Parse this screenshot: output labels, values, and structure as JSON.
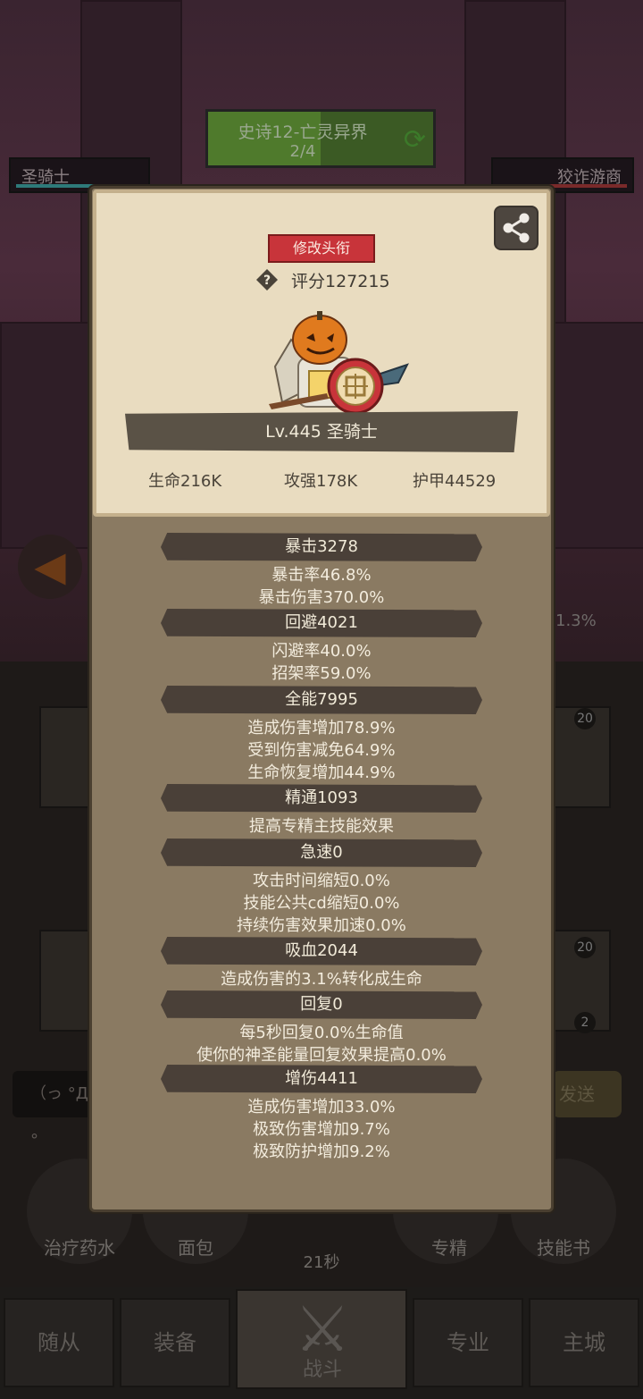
{
  "stage": {
    "name": "史诗12-亡灵异界",
    "progress": "2/4"
  },
  "player_tag": "圣骑士",
  "enemy_tag": "狡诈游商",
  "background": {
    "percent_text": "1.3%",
    "chat_placeholder": "（っ °Д °",
    "send_label": "发送",
    "badges": [
      "20",
      "20",
      "2"
    ],
    "items": [
      "治疗药水",
      "面包",
      "专精",
      "技能书"
    ],
    "timer": "21秒",
    "nav": [
      "随从",
      "装备",
      "战斗",
      "专业",
      "主城"
    ]
  },
  "panel": {
    "edit_title_label": "修改头衔",
    "score": "评分127215",
    "level_class": "Lv.445 圣骑士",
    "base_stats": [
      "生命216K",
      "攻强178K",
      "护甲44529"
    ],
    "sections": [
      {
        "header": "暴击3278",
        "lines": [
          "暴击率46.8%",
          "暴击伤害370.0%"
        ]
      },
      {
        "header": "回避4021",
        "lines": [
          "闪避率40.0%",
          "招架率59.0%"
        ]
      },
      {
        "header": "全能7995",
        "lines": [
          "造成伤害增加78.9%",
          "受到伤害减免64.9%",
          "生命恢复增加44.9%"
        ]
      },
      {
        "header": "精通1093",
        "lines": [
          "提高专精主技能效果"
        ]
      },
      {
        "header": "急速0",
        "lines": [
          "攻击时间缩短0.0%",
          "技能公共cd缩短0.0%",
          "持续伤害效果加速0.0%"
        ]
      },
      {
        "header": "吸血2044",
        "lines": [
          "造成伤害的3.1%转化成生命"
        ]
      },
      {
        "header": "回复0",
        "lines": [
          "每5秒回复0.0%生命值",
          "使你的神圣能量回复效果提高0.0%"
        ]
      },
      {
        "header": "增伤4411",
        "lines": [
          "造成伤害增加33.0%",
          "极致伤害增加9.7%",
          "极致防护增加9.2%"
        ]
      }
    ]
  },
  "colors": {
    "accent_red": "#c8343a",
    "parchment": "#e9dcc0",
    "panel_brown": "#8a7a62"
  }
}
